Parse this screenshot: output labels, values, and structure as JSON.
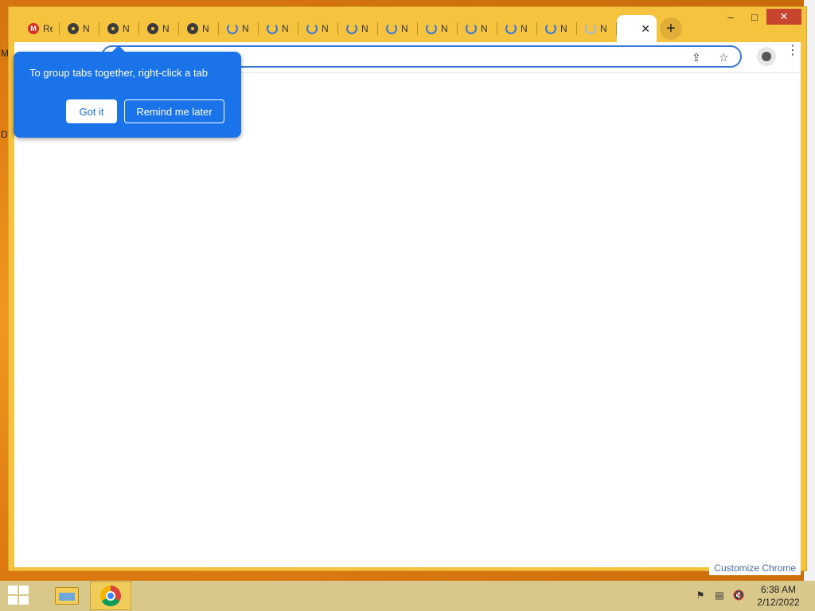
{
  "desktop": {
    "left_letters": [
      "M",
      "D"
    ]
  },
  "window": {
    "controls": {
      "minimize": "–",
      "maximize": "□",
      "close": "✕"
    },
    "tabs": [
      {
        "title": "Re",
        "favicon": "gmail-icon"
      },
      {
        "title": "N",
        "favicon": "chrome-icon"
      },
      {
        "title": "N",
        "favicon": "chrome-icon"
      },
      {
        "title": "N",
        "favicon": "chrome-icon"
      },
      {
        "title": "N",
        "favicon": "chrome-icon"
      },
      {
        "title": "N",
        "favicon": "loading-spinner-icon"
      },
      {
        "title": "N",
        "favicon": "loading-spinner-icon"
      },
      {
        "title": "N",
        "favicon": "loading-spinner-icon"
      },
      {
        "title": "N",
        "favicon": "loading-spinner-icon"
      },
      {
        "title": "N",
        "favicon": "loading-spinner-icon"
      },
      {
        "title": "N",
        "favicon": "loading-spinner-icon"
      },
      {
        "title": "N",
        "favicon": "loading-spinner-icon"
      },
      {
        "title": "N",
        "favicon": "loading-spinner-icon"
      },
      {
        "title": "N",
        "favicon": "loading-spinner-icon"
      },
      {
        "title": "N",
        "favicon": "loading-spinner-icon"
      }
    ],
    "active_tab": {
      "close": "✕"
    },
    "new_tab": "+",
    "address_bar": {
      "value": "",
      "share": "⇪",
      "bookmark": "☆"
    },
    "menu": "⋮",
    "customize": "Customize Chrome"
  },
  "promo": {
    "message": "To group tabs together, right-click a tab",
    "primary_button": "Got it",
    "secondary_button": "Remind me later"
  },
  "taskbar": {
    "time": "6:38 AM",
    "date": "2/12/2022"
  },
  "colors": {
    "accent": "#1a73e8",
    "frame": "#f6c33f",
    "close": "#c7442e"
  }
}
